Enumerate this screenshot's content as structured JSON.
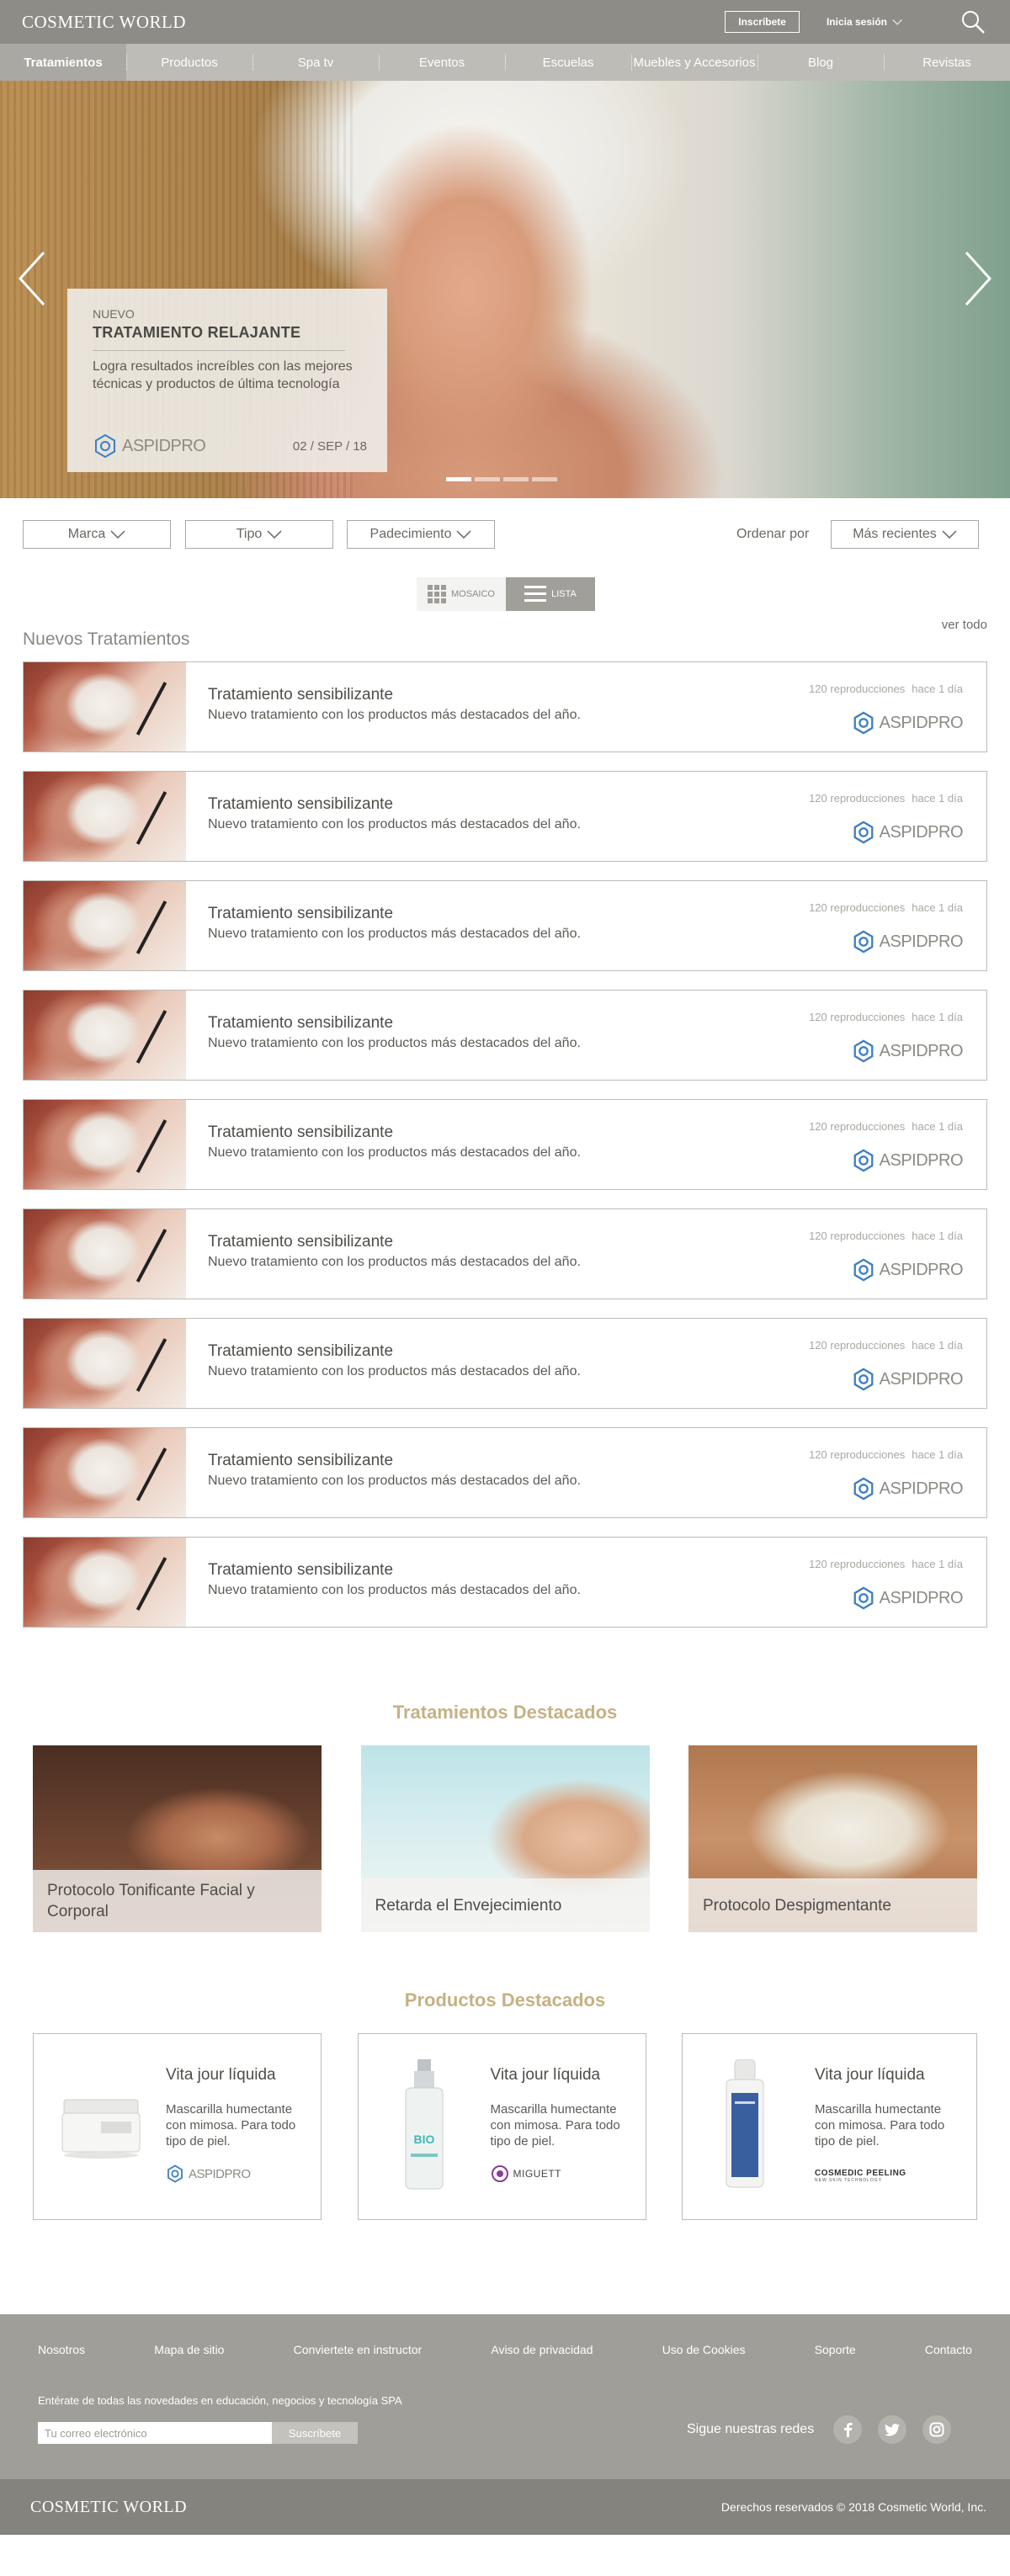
{
  "header": {
    "brand": "COSMETIC WORLD",
    "signup_label": "Inscríbete",
    "login_label": "Inicia sesión"
  },
  "nav": {
    "items": [
      "Tratamientos",
      "Productos",
      "Spa tv",
      "Eventos",
      "Escuelas",
      "Muebles y Accesorios",
      "Blog",
      "Revistas"
    ],
    "active": "Tratamientos"
  },
  "hero": {
    "kicker": "NUEVO",
    "title": "TRATAMIENTO RELAJANTE",
    "description": "Logra resultados increíbles con las mejores técnicas y productos de última tecnología",
    "date": "02 / SEP / 18",
    "brand_logo": "ASPIDPRO",
    "slides_total": 4,
    "active_slide": 1
  },
  "filters": {
    "marca": "Marca",
    "tipo": "Tipo",
    "padecimiento": "Padecimiento",
    "sort_label": "Ordenar por",
    "sort_value": "Más recientes"
  },
  "view_toggle": {
    "mosaic_label": "MOSAICO",
    "list_label": "LISTA",
    "active": "list"
  },
  "new_treatments": {
    "title": "Nuevos Tratamientos",
    "see_all": "ver todo",
    "items": [
      {
        "title": "Tratamiento sensibilizante",
        "description": "Nuevo tratamiento con los productos más destacados del año.",
        "plays": "120 reproducciones",
        "age": "hace 1 día",
        "brand": "ASPIDPRO"
      },
      {
        "title": "Tratamiento sensibilizante",
        "description": "Nuevo tratamiento con los productos más destacados del año.",
        "plays": "120 reproducciones",
        "age": "hace 1 día",
        "brand": "ASPIDPRO"
      },
      {
        "title": "Tratamiento sensibilizante",
        "description": "Nuevo tratamiento con los productos más destacados del año.",
        "plays": "120 reproducciones",
        "age": "hace 1 día",
        "brand": "ASPIDPRO"
      },
      {
        "title": "Tratamiento sensibilizante",
        "description": "Nuevo tratamiento con los productos más destacados del año.",
        "plays": "120 reproducciones",
        "age": "hace 1 día",
        "brand": "ASPIDPRO"
      },
      {
        "title": "Tratamiento sensibilizante",
        "description": "Nuevo tratamiento con los productos más destacados del año.",
        "plays": "120 reproducciones",
        "age": "hace 1 día",
        "brand": "ASPIDPRO"
      },
      {
        "title": "Tratamiento sensibilizante",
        "description": "Nuevo tratamiento con los productos más destacados del año.",
        "plays": "120 reproducciones",
        "age": "hace 1 día",
        "brand": "ASPIDPRO"
      },
      {
        "title": "Tratamiento sensibilizante",
        "description": "Nuevo tratamiento con los productos más destacados del año.",
        "plays": "120 reproducciones",
        "age": "hace 1 día",
        "brand": "ASPIDPRO"
      },
      {
        "title": "Tratamiento sensibilizante",
        "description": "Nuevo tratamiento con los productos más destacados del año.",
        "plays": "120 reproducciones",
        "age": "hace 1 día",
        "brand": "ASPIDPRO"
      },
      {
        "title": "Tratamiento sensibilizante",
        "description": "Nuevo tratamiento con los productos más destacados del año.",
        "plays": "120 reproducciones",
        "age": "hace 1 día",
        "brand": "ASPIDPRO"
      }
    ]
  },
  "featured_treatments": {
    "title": "Tratamientos Destacados",
    "items": [
      {
        "caption": "Protocolo Tonificante Facial y Corporal"
      },
      {
        "caption": "Retarda el Envejecimiento"
      },
      {
        "caption": "Protocolo Despigmentante"
      }
    ]
  },
  "featured_products": {
    "title": "Productos Destacados",
    "items": [
      {
        "name": "Vita jour líquida",
        "description": "Mascarilla humectante con mimosa. Para todo tipo de piel.",
        "brand": "ASPIDPRO"
      },
      {
        "name": "Vita jour líquida",
        "description": "Mascarilla humectante con mimosa. Para todo tipo de piel.",
        "brand": "MIGUETT"
      },
      {
        "name": "Vita jour líquida",
        "description": "Mascarilla humectante con mimosa. Para todo tipo de piel.",
        "brand": "COSMEDIC PEELING",
        "brand_sub": "NEW SKIN TECHNOLOGY"
      }
    ]
  },
  "footer": {
    "links": [
      "Nosotros",
      "Mapa de sitio",
      "Conviertete en instructor",
      "Aviso de privacidad",
      "Uso de Cookies",
      "Soporte",
      "Contacto"
    ],
    "newsletter_text": "Entérate de todas las novedades en educación, negocios y tecnología SPA",
    "email_placeholder": "Tu correo electrónico",
    "subscribe_label": "Suscríbete",
    "social_label": "Sigue nuestras redes",
    "social_icons": [
      "facebook-icon",
      "twitter-icon",
      "instagram-icon"
    ],
    "brand": "COSMETIC WORLD",
    "copyright": "Derechos reservados © 2018 Cosmetic World, Inc."
  },
  "colors": {
    "topbar": "#8e8c86",
    "navbar": "#bdbcb7",
    "accent_gold": "#c6b183",
    "footer": "#9f9e98"
  }
}
